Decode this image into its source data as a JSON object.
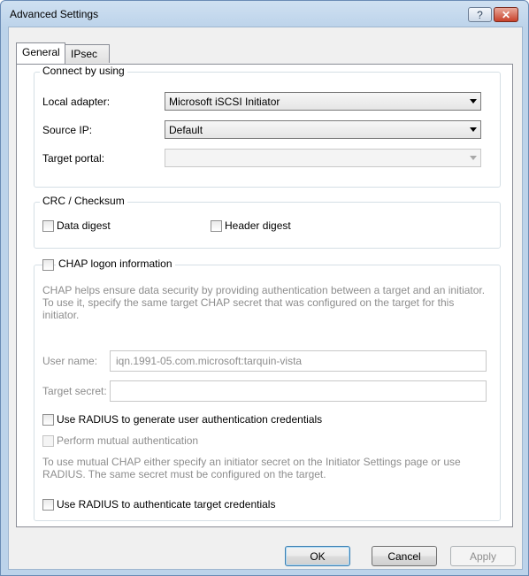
{
  "window": {
    "title": "Advanced Settings",
    "help_glyph": "?",
    "close_glyph": "✕"
  },
  "tabs": [
    {
      "label": "General",
      "active": true
    },
    {
      "label": "IPsec",
      "active": false
    }
  ],
  "connect": {
    "legend": "Connect by using",
    "local_adapter_label": "Local adapter:",
    "local_adapter_value": "Microsoft iSCSI Initiator",
    "source_ip_label": "Source IP:",
    "source_ip_value": "Default",
    "target_portal_label": "Target portal:",
    "target_portal_value": ""
  },
  "crc": {
    "legend": "CRC / Checksum",
    "data_digest": "Data digest",
    "header_digest": "Header digest"
  },
  "chap": {
    "legend": "CHAP logon information",
    "description": "CHAP helps ensure data security by providing authentication between a target and an initiator. To use it, specify the same target CHAP secret that was configured on the target for this initiator.",
    "user_name_label": "User name:",
    "user_name_value": "iqn.1991-05.com.microsoft:tarquin-vista",
    "target_secret_label": "Target secret:",
    "target_secret_value": "",
    "radius_user_auth": "Use RADIUS to generate user authentication credentials",
    "mutual_auth": "Perform mutual authentication",
    "mutual_note": "To use mutual CHAP either specify an initiator secret on the Initiator Settings page or use RADIUS.  The same secret must be configured on the target.",
    "radius_target_auth": "Use RADIUS to authenticate target credentials"
  },
  "buttons": {
    "ok": "OK",
    "cancel": "Cancel",
    "apply": "Apply"
  },
  "colors": {
    "title_bar": "#bcd3ea",
    "close_button": "#c8412a",
    "disabled_text": "#8d8d8d",
    "default_button_border": "#3c7fb1"
  }
}
